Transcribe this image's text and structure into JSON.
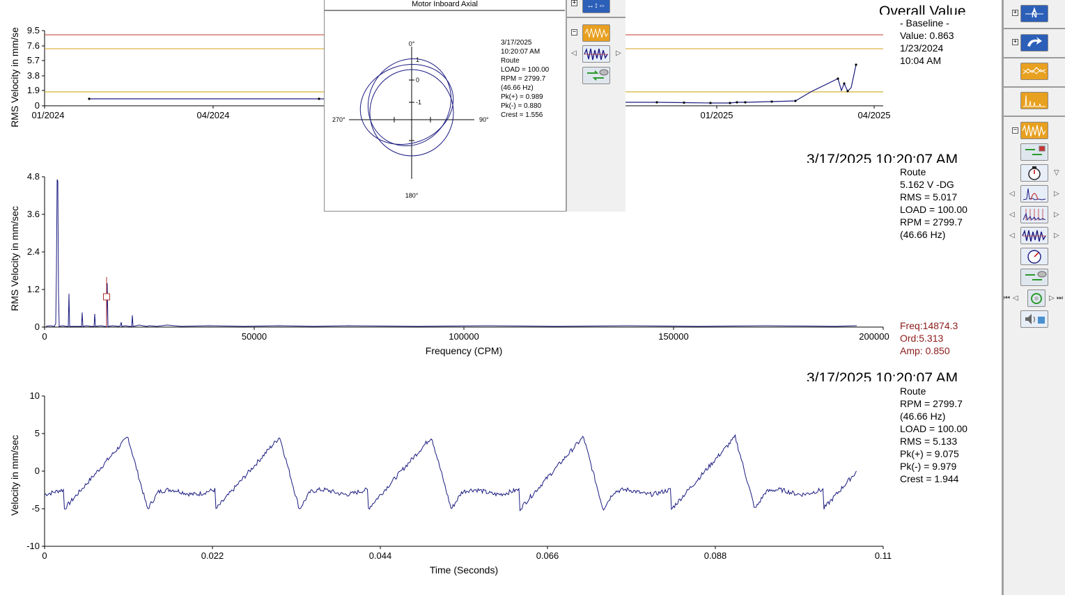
{
  "trend": {
    "title": "Overall Value",
    "ylabel": "RMS Velocity in mm/se",
    "yticks": [
      "9.5",
      "7.6",
      "5.7",
      "3.8",
      "1.9",
      "0"
    ],
    "xticks": [
      "01/2024",
      "04/2024",
      "01/2025",
      "04/2025"
    ],
    "info": [
      "- Baseline -",
      "Value: 0.863",
      "1/23/2024",
      "10:04 AM"
    ],
    "alarm_colors": {
      "alert": "#c0392b",
      "warning": "#d4a017",
      "baseline": "#c8a000"
    }
  },
  "spectrum": {
    "timestamp": "3/17/2025 10:20:07 AM",
    "ylabel": "RMS Velocity in mm/sec",
    "xlabel": "Frequency (CPM)",
    "yticks": [
      "4.8",
      "3.6",
      "2.4",
      "1.2",
      "0"
    ],
    "xticks": [
      "0",
      "50000",
      "100000",
      "150000",
      "200000"
    ],
    "info": [
      "Route",
      "5.162 V -DG",
      "RMS = 5.017",
      "LOAD = 100.00",
      "RPM = 2799.7",
      "(46.66 Hz)"
    ],
    "cursor": [
      "Freq:14874.3",
      "Ord:5.313",
      "Amp: 0.850"
    ],
    "cursor_color": "#8b1a1a"
  },
  "waveform": {
    "timestamp": "3/17/2025 10:20:07 AM",
    "ylabel": "Velocity in mm/sec",
    "xlabel": "Time (Seconds)",
    "yticks": [
      "10",
      "5",
      "0",
      "-5",
      "-10"
    ],
    "xticks": [
      "0",
      "0.022",
      "0.044",
      "0.066",
      "0.088",
      "0.11"
    ],
    "info": [
      "Route",
      "RPM = 2799.7",
      "(46.66 Hz)",
      "LOAD = 100.00",
      "RMS = 5.133",
      "Pk(+) = 9.075",
      "Pk(-) = 9.979",
      "Crest = 1.944"
    ]
  },
  "orbit_popup": {
    "title": "Motor Inboard Axial",
    "angles": [
      "0°",
      "90°",
      "180°",
      "270°"
    ],
    "inner_ticks": [
      "1",
      "0",
      "-1"
    ],
    "info": [
      "3/17/2025",
      "10:20:07 AM",
      "Route",
      "LOAD = 100.00",
      "RPM = 2799.7",
      "(46.66 Hz)",
      "Pk(+) = 0.989",
      "Pk(-) = 0.880",
      "Crest = 1.556"
    ]
  },
  "colors": {
    "trace": "#1a1a80",
    "toolbar_bg": "#f0f0f0",
    "button_blue": "#2c5fb8",
    "button_orange": "#e8a020"
  },
  "toolbar": {
    "buttons": [
      "navigator-icon",
      "refresh-arrow-icon",
      "trend-plot-icon",
      "spectrum-plot-icon",
      "waveform-plot-icon",
      "route-exchange-icon",
      "timer-icon",
      "spectrum-peak-icon",
      "spectrum-harmonics-icon",
      "waveform-icon",
      "gauge-icon",
      "route-exchange-icon",
      "cycle-icon",
      "speaker-icon"
    ]
  }
}
